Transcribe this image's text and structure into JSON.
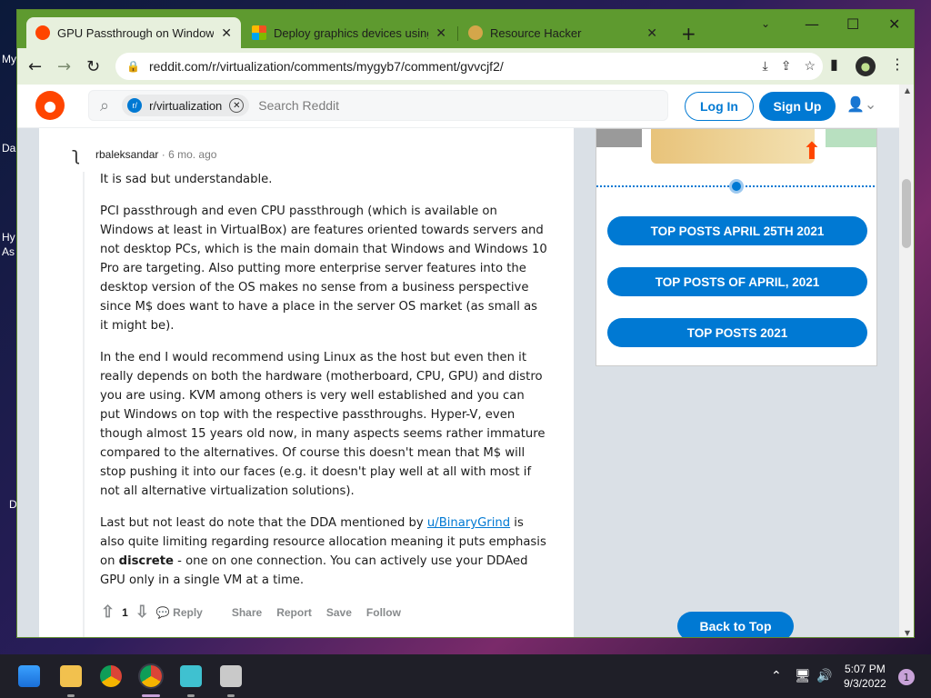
{
  "desktop": {
    "labels": [
      "My",
      "Da",
      "Hy",
      "As",
      "D"
    ]
  },
  "browser": {
    "tabs": [
      {
        "title": "GPU Passthrough on Windows H",
        "active": true
      },
      {
        "title": "Deploy graphics devices using D",
        "active": false
      },
      {
        "title": "Resource Hacker",
        "active": false
      }
    ],
    "url": "reddit.com/r/virtualization/comments/mygyb7/comment/gvvcjf2/"
  },
  "reddit_header": {
    "subreddit_chip": "r/virtualization",
    "search_placeholder": "Search Reddit",
    "login_label": "Log In",
    "signup_label": "Sign Up"
  },
  "comment": {
    "author": "rbaleksandar",
    "time": "6 mo. ago",
    "paragraphs": [
      "It is sad but understandable.",
      "PCI passthrough and even CPU passthrough (which is available on Windows at least in VirtualBox) are features oriented towards servers and not desktop PCs, which is the main domain that Windows and Windows 10 Pro are targeting. Also putting more enterprise server features into the desktop version of the OS makes no sense from a business perspective since M$ does want to have a place in the server OS market (as small as it might be).",
      "In the end I would recommend using Linux as the host but even then it really depends on both the hardware (motherboard, CPU, GPU) and distro you are using. KVM among others is very well established and you can put Windows on top with the respective passthroughs. Hyper-V, even though almost 15 years old now, in many aspects seems rather immature compared to the alternatives. Of course this doesn't mean that M$ will stop pushing it into our faces (e.g. it doesn't play well at all with most if not all alternative virtualization solutions)."
    ],
    "last_paragraph": {
      "before_link": "Last but not least do note that the DDA mentioned by ",
      "link": "u/BinaryGrind",
      "after_link": " is also quite limiting regarding resource allocation meaning it puts emphasis on ",
      "bold": "discrete",
      "after_bold": " - one on one connection. You can actively use your DDAed GPU only in a single VM at a time."
    },
    "vote_count": "1",
    "actions": [
      "Reply",
      "Share",
      "Report",
      "Save",
      "Follow"
    ]
  },
  "sidebar": {
    "buttons": [
      "TOP POSTS APRIL 25TH 2021",
      "TOP POSTS OF APRIL, 2021",
      "TOP POSTS 2021"
    ],
    "back_to_top": "Back to Top"
  },
  "taskbar": {
    "time": "5:07 PM",
    "date": "9/3/2022",
    "notification_count": "1"
  },
  "colors": {
    "tabbar": "#5e9a2f",
    "reddit_blue": "#0079d3",
    "reddit_orange": "#ff4500"
  }
}
